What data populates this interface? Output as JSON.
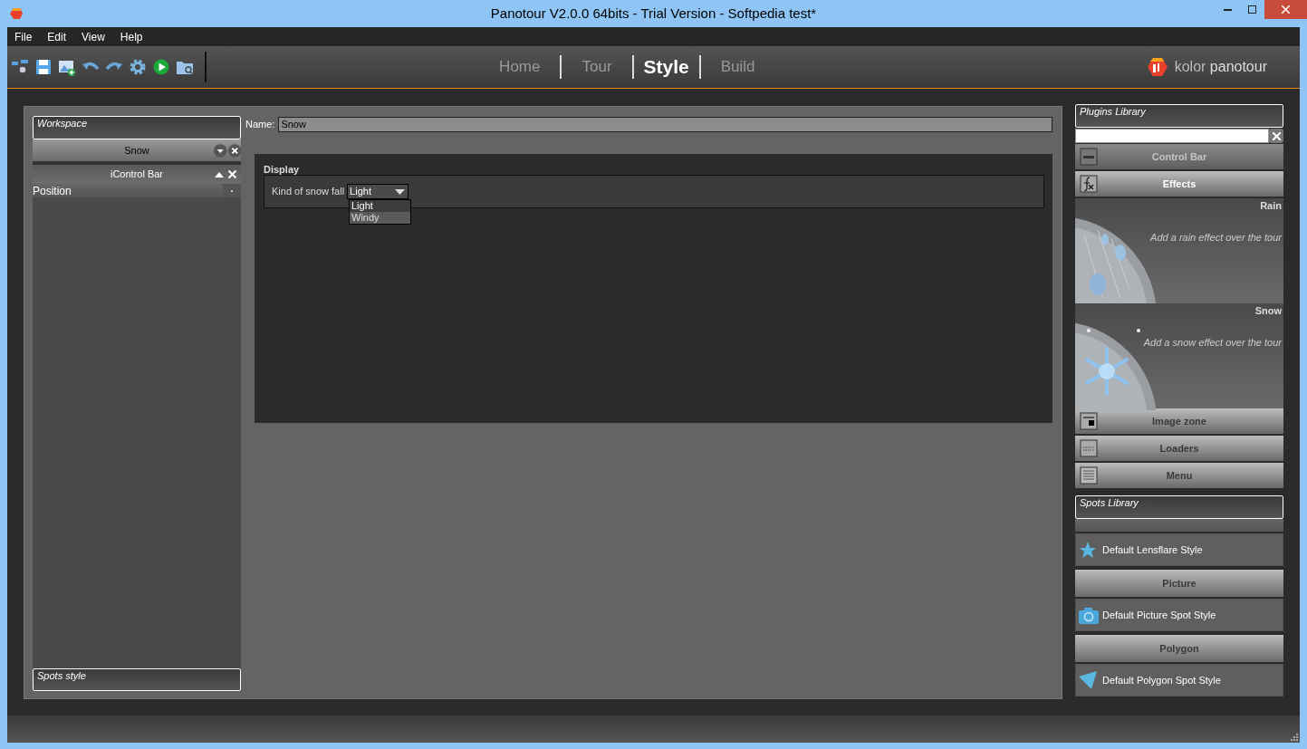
{
  "window": {
    "title": "Panotour V2.0.0 64bits - Trial Version - Softpedia test*"
  },
  "menu": [
    "File",
    "Edit",
    "View",
    "Help"
  ],
  "nav_tabs": [
    {
      "label": "Home",
      "selected": false
    },
    {
      "label": "Tour",
      "selected": false
    },
    {
      "label": "Style",
      "selected": true
    },
    {
      "label": "Build",
      "selected": false
    }
  ],
  "logo": {
    "word_1": "kolor",
    "word_2": "panotour"
  },
  "workspace": {
    "title": "Workspace",
    "items": [
      {
        "label": "Snow",
        "kind": "style"
      },
      {
        "label": "iControl Bar",
        "kind": "plugin"
      }
    ],
    "property": "Position",
    "spots_title": "Spots style"
  },
  "editor": {
    "name_label": "Name:",
    "name_value": "Snow",
    "section": "Display",
    "field_label": "Kind of snow fall",
    "field_value": "Light",
    "options": [
      {
        "label": "Light",
        "selected": true
      },
      {
        "label": "Windy",
        "selected": false
      }
    ]
  },
  "plugins_library": {
    "title": "Plugins Library",
    "entries": [
      {
        "kind": "category",
        "label": "Control Bar",
        "disabled": true
      },
      {
        "kind": "category",
        "label": "Effects",
        "disabled": false
      },
      {
        "kind": "effect",
        "label": "Rain",
        "description": "Add a rain effect over the tour"
      },
      {
        "kind": "effect",
        "label": "Snow",
        "description": "Add a snow effect over the tour"
      },
      {
        "kind": "category",
        "label": "Image zone",
        "disabled": false
      },
      {
        "kind": "category",
        "label": "Loaders",
        "disabled": false
      },
      {
        "kind": "category",
        "label": "Menu",
        "disabled": false
      }
    ]
  },
  "spots_library": {
    "title": "Spots Library",
    "entries": [
      {
        "kind": "item",
        "label": "Default Lensflare Style"
      },
      {
        "kind": "heading",
        "label": "Picture"
      },
      {
        "kind": "item",
        "label": "Default Picture Spot Style"
      },
      {
        "kind": "heading",
        "label": "Polygon"
      },
      {
        "kind": "item",
        "label": "Default Polygon Spot Style"
      }
    ]
  }
}
